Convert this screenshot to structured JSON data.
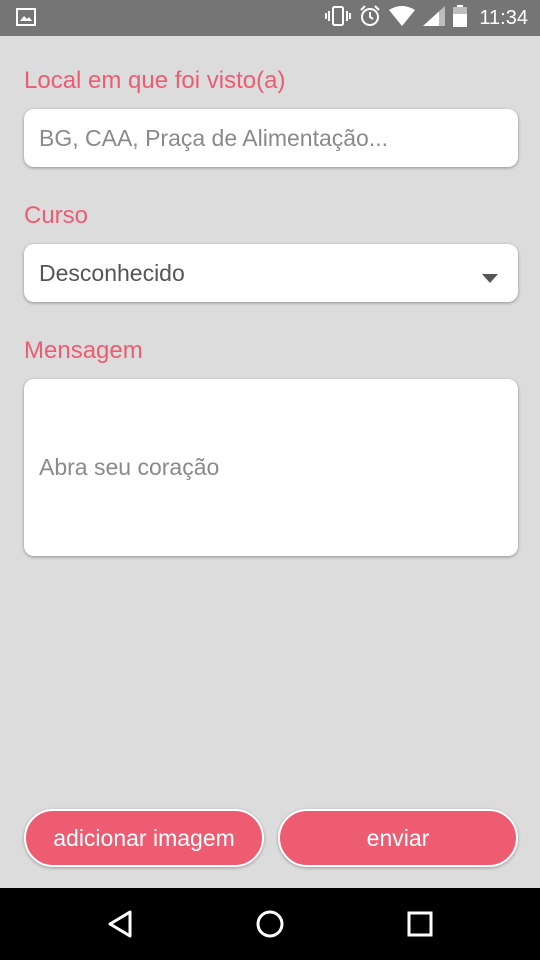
{
  "status_bar": {
    "time": "11:34",
    "icons": [
      "image-icon",
      "vibrate-icon",
      "alarm-icon",
      "wifi-icon",
      "signal-icon",
      "battery-icon"
    ]
  },
  "form": {
    "local": {
      "label": "Local em que foi visto(a)",
      "placeholder": "BG, CAA, Praça de Alimentação..."
    },
    "curso": {
      "label": "Curso",
      "selected": "Desconhecido"
    },
    "mensagem": {
      "label": "Mensagem",
      "placeholder": "Abra seu coração"
    }
  },
  "actions": {
    "add_image": "adicionar imagem",
    "send": "enviar"
  },
  "colors": {
    "accent": "#ee5c72",
    "background": "#dcdcdc",
    "status_bar": "#757575"
  }
}
